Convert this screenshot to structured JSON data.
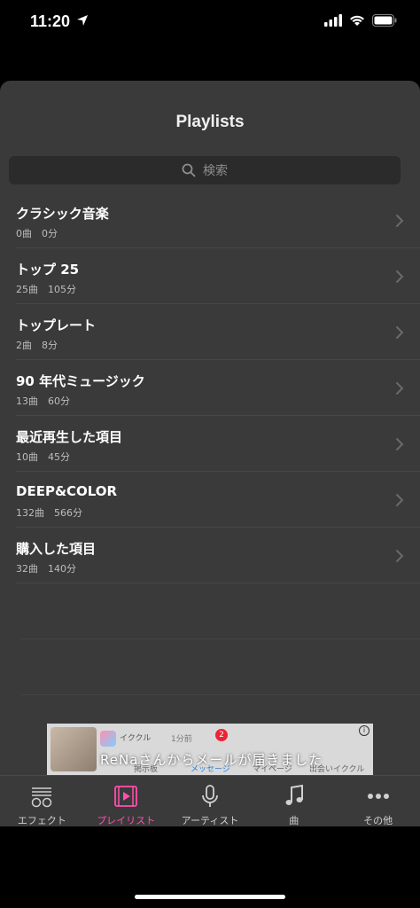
{
  "status": {
    "time": "11:20"
  },
  "nav": {
    "title": "Playlists"
  },
  "search": {
    "placeholder": "検索"
  },
  "playlists": [
    {
      "title": "クラシック音楽",
      "meta": "0曲　0分"
    },
    {
      "title": "トップ 25",
      "meta": "25曲　105分"
    },
    {
      "title": "トップレート",
      "meta": "2曲　8分"
    },
    {
      "title": "90 年代ミュージック",
      "meta": "13曲　60分"
    },
    {
      "title": "最近再生した項目",
      "meta": "10曲　45分"
    },
    {
      "title": "DEEP&COLOR",
      "meta": "132曲　566分"
    },
    {
      "title": "購入した項目",
      "meta": "32曲　140分"
    }
  ],
  "ad": {
    "app_name": "イククル",
    "time": "1分前",
    "message": "ReNaさんからメールが届きました",
    "badge": "2",
    "icon_labels": [
      "掲示板",
      "メッセージ",
      "マイページ",
      "出会いイククル"
    ]
  },
  "tabs": [
    {
      "label": "エフェクト",
      "icon": "equalizer-icon"
    },
    {
      "label": "プレイリスト",
      "icon": "playlist-icon",
      "active": true
    },
    {
      "label": "アーティスト",
      "icon": "microphone-icon"
    },
    {
      "label": "曲",
      "icon": "music-note-icon"
    },
    {
      "label": "その他",
      "icon": "more-icon"
    }
  ],
  "colors": {
    "accent": "#ff4fb0",
    "background": "#3a3a3a"
  }
}
